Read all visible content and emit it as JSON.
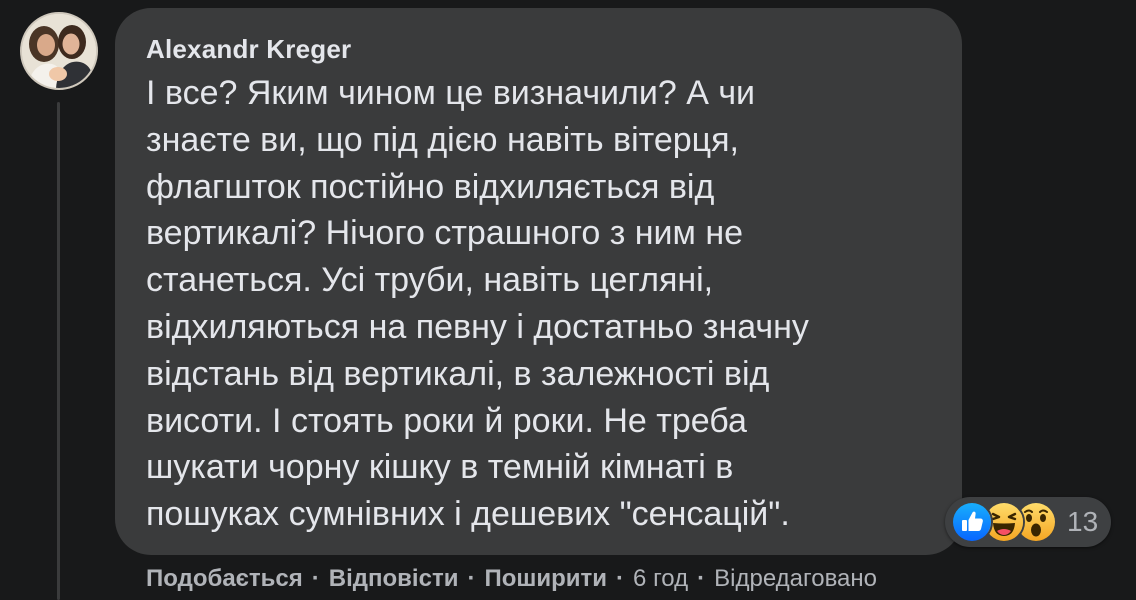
{
  "comment": {
    "author": "Alexandr Kreger",
    "text_lines": [
      "І все? Яким чином це визначили? А чи",
      "знаєте ви, що під дією навіть вітерця,",
      "флагшток постійно відхиляється від",
      "вертикалі? Нічого страшного з ним не",
      "станеться. Усі труби, навіть цегляні,",
      "відхиляються на певну і достатньо значну",
      "відстань від вертикалі, в залежності від",
      "висоти. І стоять роки й роки. Не треба",
      "шукати чорну кішку в темній кімнаті в",
      "пошуках сумнівних і дешевих \"сенсацій\"."
    ]
  },
  "reactions": {
    "icons": [
      "like-icon",
      "haha-icon",
      "wow-icon"
    ],
    "count": "13"
  },
  "actions": {
    "like": "Подобається",
    "reply": "Відповісти",
    "share": "Поширити",
    "time": "6 год",
    "edited": "Відредаговано",
    "separator": "·"
  },
  "colors": {
    "background": "#18191a",
    "bubble": "#3a3b3c",
    "text": "#e4e6eb",
    "secondary_text": "#b0b3b8",
    "like_blue": "#1877f2",
    "emoji_yellow": "#f7b125"
  }
}
